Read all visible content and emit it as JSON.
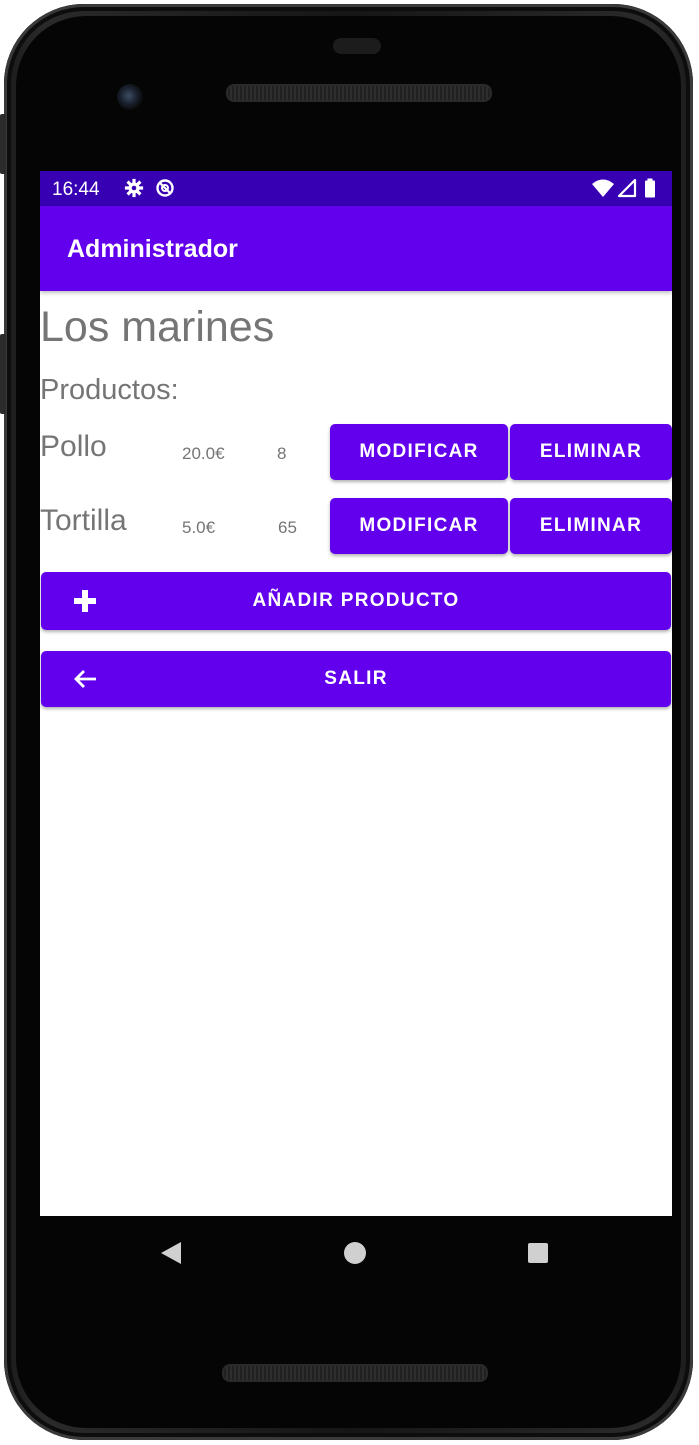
{
  "status_bar": {
    "time": "16:44",
    "icons": [
      "settings-icon",
      "sync-icon",
      "wifi-icon",
      "signal-icon",
      "battery-icon"
    ]
  },
  "app_bar": {
    "title": "Administrador"
  },
  "store": {
    "name": "Los marines"
  },
  "products": {
    "label": "Productos:",
    "items": [
      {
        "name": "Pollo",
        "price": "20.0€",
        "quantity": "8",
        "modify_label": "MODIFICAR",
        "delete_label": "ELIMINAR"
      },
      {
        "name": "Tortilla",
        "price": "5.0€",
        "quantity": "65",
        "modify_label": "MODIFICAR",
        "delete_label": "ELIMINAR"
      }
    ]
  },
  "actions": {
    "add_label": "AÑADIR PRODUCTO",
    "add_icon": "plus-icon",
    "exit_label": "SALIR",
    "exit_icon": "arrow-left-icon"
  },
  "nav_bar": {
    "icons": [
      "back-icon",
      "home-icon",
      "overview-icon"
    ]
  },
  "colors": {
    "primary": "#6200ee",
    "primary_dark": "#3700b3",
    "text_secondary": "#757575"
  }
}
